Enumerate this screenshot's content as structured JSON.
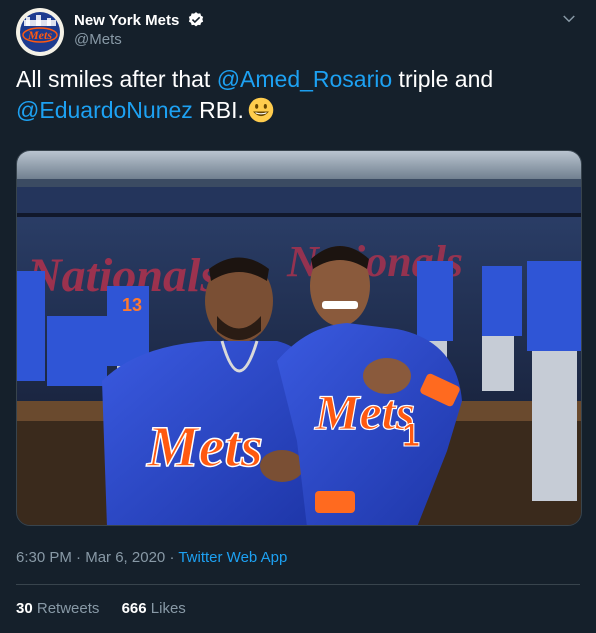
{
  "account": {
    "display_name": "New York Mets",
    "handle": "@Mets",
    "avatar_text": "Mets"
  },
  "tweet": {
    "text_1": "All smiles after that ",
    "mention_1": "@Amed_Rosario",
    "text_2": " triple and ",
    "mention_2": "@EduardoNunez",
    "text_3": " RBI.",
    "emoji": "smiling-face-emoji"
  },
  "photo": {
    "jersey_text": "Mets",
    "number_left": "13",
    "number_right": "1",
    "dugout_sign": "Nationals"
  },
  "meta": {
    "time": "6:30 PM",
    "separator": "·",
    "date": "Mar 6, 2020",
    "app": "Twitter Web App"
  },
  "stats": {
    "retweets_count": "30",
    "retweets_label": "Retweets",
    "likes_count": "666",
    "likes_label": "Likes"
  },
  "colors": {
    "background": "#15202b",
    "link": "#1da1f2",
    "secondary_text": "#8899a6",
    "mets_blue": "#2b4bd1",
    "mets_orange": "#ff5910"
  }
}
